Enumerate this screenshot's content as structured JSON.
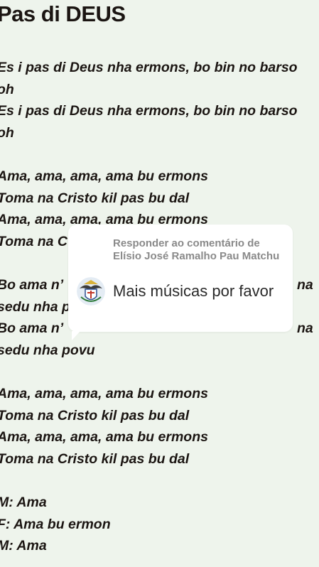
{
  "title": "Pas di DEUS",
  "lyrics": [
    "Es i pas di Deus nha ermons, bo bin no barso",
    "oh",
    "Es i pas di Deus nha ermons, bo bin no barso",
    "oh",
    "Ama, ama, ama, ama  bu ermons",
    "Toma na Cristo kil pas bu dal",
    "Ama, ama, ama, ama bu ermons",
    "Toma na C",
    "Bo ama n’",
    "na",
    "sedu nha p",
    "Bo ama n’",
    "na",
    "sedu nha povu",
    "Ama, ama, ama, ama  bu ermons",
    "Toma na Cristo kil pas bu dal",
    "Ama, ama, ama, ama  bu ermons",
    "Toma na Cristo kil pas bu dal",
    "M: Ama",
    "F: Ama bu ermon",
    "M: Ama"
  ],
  "reply_sticker": {
    "heading": "Responder ao comentário de Elísio José Ramalho Pau Matchu",
    "text": "Mais músicas por favor",
    "avatar_icon": "coat-of-arms-icon"
  },
  "colors": {
    "background": "#eef4ec",
    "text": "#1b1512",
    "card": "#ffffff",
    "heading": "#8a8a8a"
  }
}
